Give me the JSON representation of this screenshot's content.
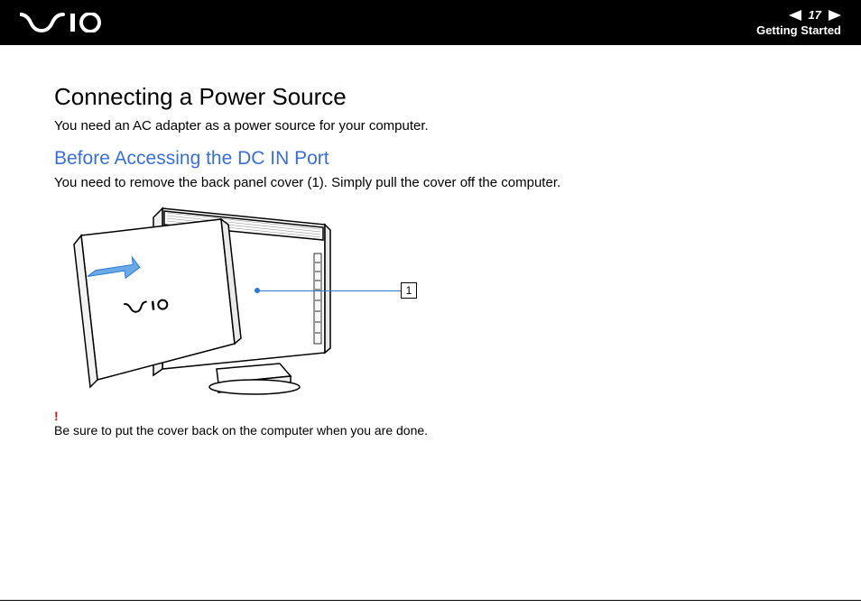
{
  "header": {
    "page_number": "17",
    "section": "Getting Started"
  },
  "content": {
    "heading": "Connecting a Power Source",
    "intro": "You need an AC adapter as a power source for your computer.",
    "subheading": "Before Accessing the DC IN Port",
    "desc": "You need to remove the back panel cover (1). Simply pull the cover off the computer.",
    "callout_label": "1",
    "warn_mark": "!",
    "warn_text": "Be sure to put the cover back on the computer when you are done."
  }
}
